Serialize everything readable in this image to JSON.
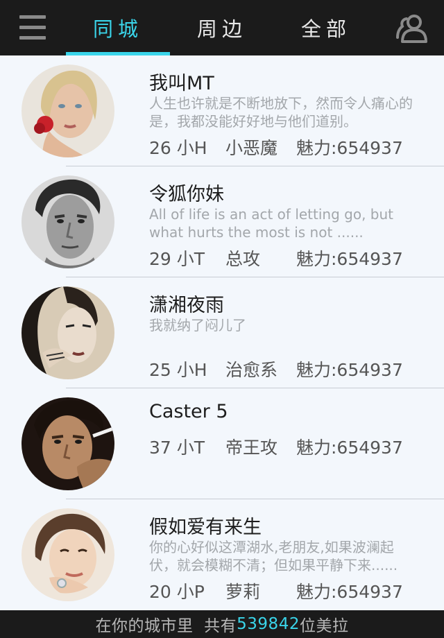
{
  "header": {
    "menu_icon": "hamburger-menu-icon",
    "contacts_icon": "contacts-icon",
    "accent_color": "#3ad5ea",
    "tabs": [
      {
        "label": "同城",
        "active": true
      },
      {
        "label": "周边",
        "active": false
      },
      {
        "label": "全部",
        "active": false
      }
    ]
  },
  "users": [
    {
      "name": "我叫MT",
      "bio": "人生也许就是不断地放下，然而令人痛心的是，我都没能好好地与他们道别。",
      "age": "26 小H",
      "tag": "小恶魔",
      "charm": "魅力:654937"
    },
    {
      "name": "令狐你妹",
      "bio": "All of life is an act of letting go, but what hurts the most is not ......",
      "age": "29 小T",
      "tag": "总攻",
      "charm": "魅力:654937"
    },
    {
      "name": "潇湘夜雨",
      "bio": "我就纳了闷儿了",
      "age": "25 小H",
      "tag": "治愈系",
      "charm": "魅力:654937"
    },
    {
      "name": "Caster 5",
      "bio": "",
      "age": "37 小T",
      "tag": "帝王攻",
      "charm": "魅力:654937"
    },
    {
      "name": "假如爱有来生",
      "bio": "你的心好似这潭湖水,老朋友,如果波澜起伏，就会模糊不清；但如果平静下来......",
      "age": "20 小P",
      "tag": "萝莉",
      "charm": "魅力:654937"
    }
  ],
  "footer": {
    "prefix": "在你的城市里  共有",
    "count": "539842",
    "suffix": "位美拉"
  }
}
